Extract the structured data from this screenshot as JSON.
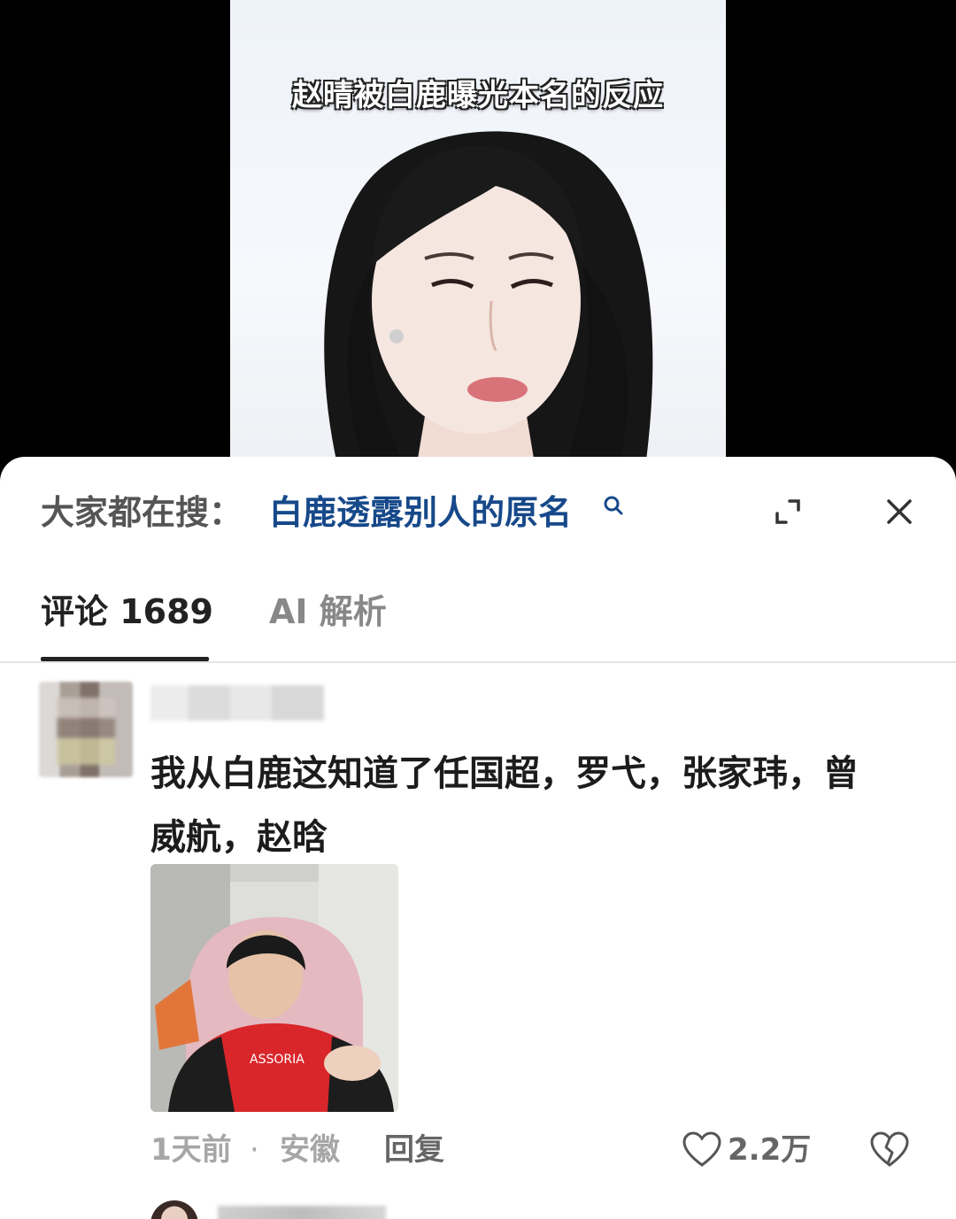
{
  "video": {
    "caption": "赵晴被白鹿曝光本名的反应"
  },
  "sheet": {
    "search_prefix": "大家都在搜：",
    "search_term": "白鹿透露别人的原名"
  },
  "tabs": {
    "comments_label": "评论 1689",
    "ai_label": "AI 解析"
  },
  "comment": {
    "text_line1": "我从白鹿这知道了任国超，罗弋，张家玮，曾",
    "text_line2": "威航，赵晗",
    "time": "1天前",
    "separator": "·",
    "location": "安徽",
    "reply_label": "回复",
    "like_count": "2.2万"
  },
  "colors": {
    "search_term": "#17498a",
    "tab_active": "#222222",
    "tab_inactive": "#888888"
  }
}
